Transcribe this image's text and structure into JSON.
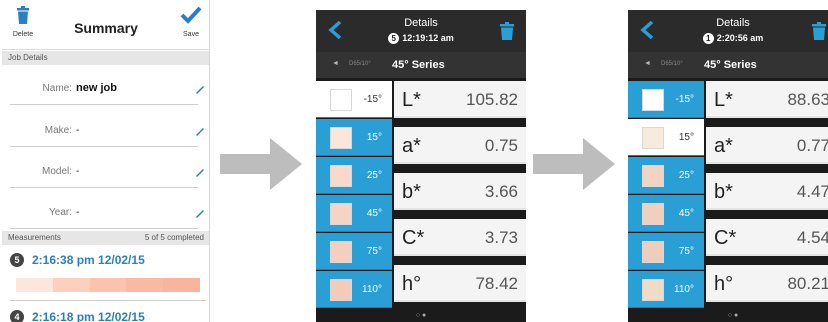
{
  "summary": {
    "title": "Summary",
    "delete_label": "Delete",
    "save_label": "Save",
    "job_section": "Job Details",
    "fields": [
      {
        "label": "Name:",
        "value": "new job"
      },
      {
        "label": "Make:",
        "value": "-"
      },
      {
        "label": "Model:",
        "value": "-"
      },
      {
        "label": "Year:",
        "value": "-"
      }
    ],
    "measurements_section": "Measurements",
    "measurements_status": "5 of 5 completed",
    "measurements": [
      {
        "num": "5",
        "time": "2:16:38 pm 12/02/15"
      },
      {
        "num": "4",
        "time": "2:16:18 pm 12/02/15"
      }
    ],
    "swatch_colors": [
      "#fde7dc",
      "#fcd0bf",
      "#fbc3ae",
      "#f9b9a2",
      "#f8b49c"
    ]
  },
  "details_a": {
    "title": "Details",
    "badge": "5",
    "time": "12:19:12 am",
    "prev_label": "◄",
    "illuminant": "D65/10°",
    "series": "45° Series",
    "angles": [
      {
        "deg": "-15°",
        "color": "#ffffff",
        "selected": true
      },
      {
        "deg": "15°",
        "color": "#fbe6dc",
        "selected": false
      },
      {
        "deg": "25°",
        "color": "#f8d9cb",
        "selected": false
      },
      {
        "deg": "45°",
        "color": "#f6d4c5",
        "selected": false
      },
      {
        "deg": "75°",
        "color": "#f4cfbf",
        "selected": false
      },
      {
        "deg": "110°",
        "color": "#f2cbbb",
        "selected": false
      }
    ],
    "values": [
      {
        "key": "L*",
        "value": "105.82"
      },
      {
        "key": "a*",
        "value": "0.75"
      },
      {
        "key": "b*",
        "value": "3.66"
      },
      {
        "key": "C*",
        "value": "3.73"
      },
      {
        "key": "h°",
        "value": "78.42"
      }
    ],
    "page_dots": "○ ●"
  },
  "details_b": {
    "title": "Details",
    "badge": "1",
    "time": "2:20:56 am",
    "prev_label": "◄",
    "illuminant": "D65/10°",
    "series": "45° Series",
    "angles": [
      {
        "deg": "-15°",
        "color": "#ffffff",
        "selected": false
      },
      {
        "deg": "15°",
        "color": "#f7ecdb",
        "selected": true
      },
      {
        "deg": "25°",
        "color": "#f3d3c2",
        "selected": false
      },
      {
        "deg": "45°",
        "color": "#f1cfbe",
        "selected": false
      },
      {
        "deg": "75°",
        "color": "#efcdbc",
        "selected": false
      },
      {
        "deg": "110°",
        "color": "#eedcc6",
        "selected": false
      }
    ],
    "values": [
      {
        "key": "L*",
        "value": "88.63"
      },
      {
        "key": "a*",
        "value": "0.77"
      },
      {
        "key": "b*",
        "value": "4.47"
      },
      {
        "key": "C*",
        "value": "4.54"
      },
      {
        "key": "h°",
        "value": "80.21"
      }
    ],
    "page_dots": "○ ●"
  },
  "colors": {
    "accent_blue": "#2a9fd6",
    "link_blue": "#2a7fc4",
    "dark_bg": "#1b1b1b",
    "arrow_gray": "#bdbdbd"
  }
}
